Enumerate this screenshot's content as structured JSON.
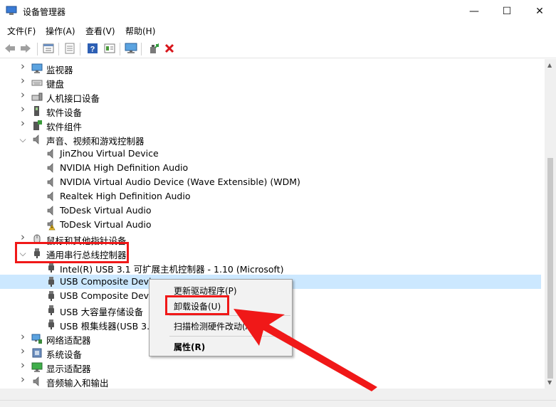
{
  "window": {
    "title": "设备管理器",
    "minimize": "—",
    "maximize": "☐",
    "close": "✕"
  },
  "menu": [
    "文件(F)",
    "操作(A)",
    "查看(V)",
    "帮助(H)"
  ],
  "toolbar": [
    "back-icon",
    "forward-icon",
    "properties-icon",
    "print-icon",
    "help-icon",
    "view-icon",
    "monitor-icon",
    "update-driver-icon",
    "remove-icon"
  ],
  "tree": [
    {
      "label": "监视器",
      "icon": "monitor-icon",
      "level": 1,
      "chevron": "collapsed"
    },
    {
      "label": "键盘",
      "icon": "keyboard-icon",
      "level": 1,
      "chevron": "collapsed"
    },
    {
      "label": "人机接口设备",
      "icon": "hid-icon",
      "level": 1,
      "chevron": "collapsed"
    },
    {
      "label": "软件设备",
      "icon": "software-device-icon",
      "level": 1,
      "chevron": "collapsed"
    },
    {
      "label": "软件组件",
      "icon": "software-component-icon",
      "level": 1,
      "chevron": "collapsed"
    },
    {
      "label": "声音、视频和游戏控制器",
      "icon": "speaker-icon",
      "level": 1,
      "chevron": "expanded"
    },
    {
      "label": "JinZhou Virtual Device",
      "icon": "speaker-icon",
      "level": 2
    },
    {
      "label": "NVIDIA High Definition Audio",
      "icon": "speaker-icon",
      "level": 2
    },
    {
      "label": "NVIDIA Virtual Audio Device (Wave Extensible) (WDM)",
      "icon": "speaker-icon",
      "level": 2
    },
    {
      "label": "Realtek High Definition Audio",
      "icon": "speaker-icon",
      "level": 2
    },
    {
      "label": "ToDesk Virtual Audio",
      "icon": "speaker-icon",
      "level": 2
    },
    {
      "label": "ToDesk Virtual Audio",
      "icon": "speaker-warning-icon",
      "level": 2
    },
    {
      "label": "鼠标和其他指针设备",
      "icon": "mouse-icon",
      "level": 1,
      "chevron": "collapsed"
    },
    {
      "label": "通用串行总线控制器",
      "icon": "usb-icon",
      "level": 1,
      "chevron": "expanded"
    },
    {
      "label": "Intel(R) USB 3.1 可扩展主机控制器 - 1.10 (Microsoft)",
      "icon": "usb-icon",
      "level": 2
    },
    {
      "label": "USB Composite Device",
      "icon": "usb-icon",
      "level": 2,
      "selected": true
    },
    {
      "label": "USB Composite Device",
      "icon": "usb-icon",
      "level": 2
    },
    {
      "label": "USB 大容量存储设备",
      "icon": "usb-icon",
      "level": 2
    },
    {
      "label": "USB 根集线器(USB 3.0)",
      "icon": "usb-icon",
      "level": 2
    },
    {
      "label": "网络适配器",
      "icon": "network-icon",
      "level": 1,
      "chevron": "collapsed"
    },
    {
      "label": "系统设备",
      "icon": "system-icon",
      "level": 1,
      "chevron": "collapsed"
    },
    {
      "label": "显示适配器",
      "icon": "display-adapter-icon",
      "level": 1,
      "chevron": "collapsed"
    },
    {
      "label": "音频输入和输出",
      "icon": "speaker-icon",
      "level": 1,
      "chevron": "collapsed"
    }
  ],
  "context_menu": {
    "update": "更新驱动程序(P)",
    "uninstall": "卸载设备(U)",
    "scan": "扫描检测硬件改动(A)",
    "properties": "属性(R)"
  },
  "colors": {
    "highlight": "#f01818",
    "selection": "#cce8ff"
  }
}
